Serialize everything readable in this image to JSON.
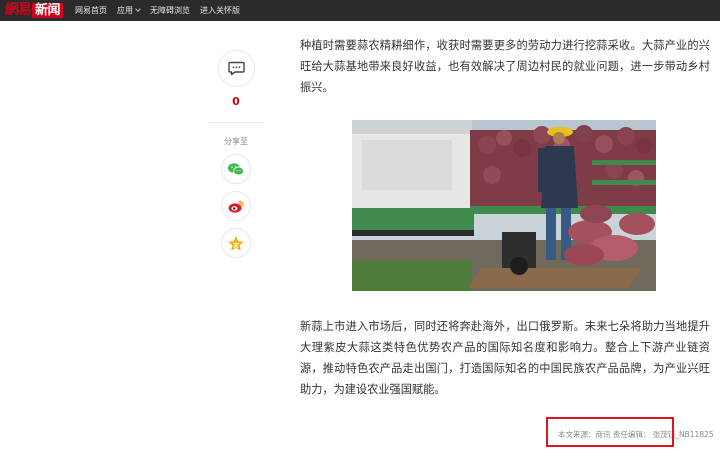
{
  "nav": {
    "logo_part1": "網易",
    "logo_part2": "新闻",
    "links": [
      "网易首页",
      "应用",
      "无障碍浏览",
      "进入关怀版"
    ]
  },
  "share": {
    "comment_count": "0",
    "label": "分享至",
    "icons": [
      "wechat-icon",
      "weibo-icon",
      "qzone-star-icon"
    ]
  },
  "article": {
    "paragraph1": "种植时需要蒜农精耕细作，收获时需要更多的劳动力进行挖蒜采收。大蒜产业的兴旺给大蒜基地带来良好收益，也有效解决了周边村民的就业问题，进一步带动乡村振兴。",
    "paragraph2": "新蒜上市进入市场后，同时还将奔赴海外，出口俄罗斯。未来七朵将助力当地提升大理紫皮大蒜这类特色优势农产品的国际知名度和影响力。整合上下游产业链资源，推动特色农产品走出国门，打造国际知名的中国民族农产品品牌，为产业兴旺助力，为建设农业强国赋能。",
    "source": "本文来源：商讯 责任编辑： 张茂钰_NB11825"
  },
  "colors": {
    "brand_red": "#d0021b",
    "nav_bg": "#2b2b2b",
    "highlight_box": "#e0141f"
  }
}
